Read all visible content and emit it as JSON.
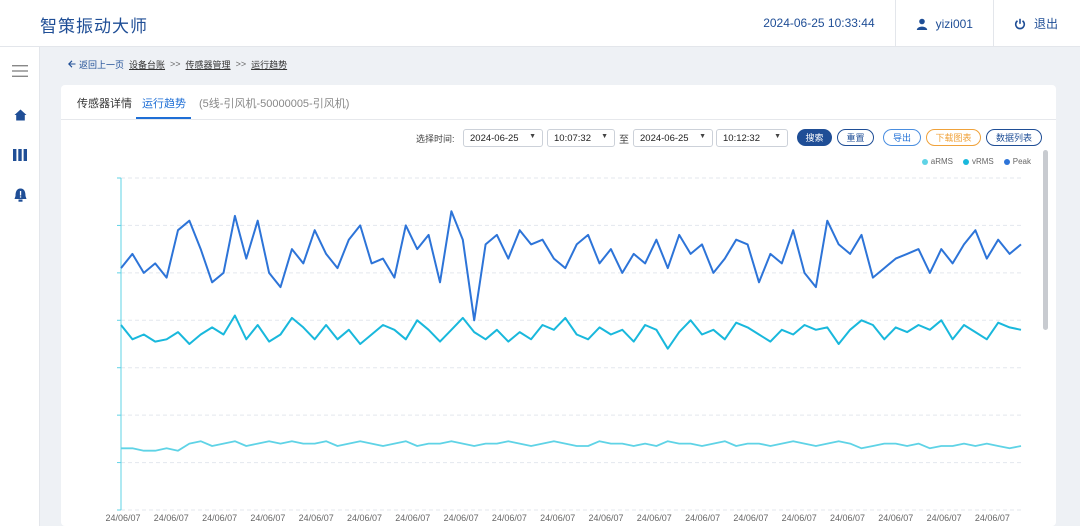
{
  "app": {
    "title": "智策振动大师"
  },
  "header": {
    "datetime": "2024-06-25 10:33:44",
    "username": "yizi001",
    "logout_label": "退出"
  },
  "sidebar": {
    "items": [
      {
        "icon": "menu-icon"
      },
      {
        "icon": "home-icon"
      },
      {
        "icon": "columns-icon"
      },
      {
        "icon": "alert-icon"
      }
    ]
  },
  "breadcrumb": {
    "back_label": "返回上一页",
    "items": [
      "设备台账",
      "传感器管理",
      "运行趋势"
    ],
    "separator": ">>"
  },
  "tabs": {
    "items": [
      "传感器详情",
      "运行趋势"
    ],
    "active": 1,
    "sensor_info": "(5线-引风机-50000005-引风机)"
  },
  "toolbar": {
    "label": "选择时间:",
    "start_date": "2024-06-25",
    "start_time": "10:07:32",
    "to_label": "至",
    "end_date": "2024-06-25",
    "end_time": "10:12:32",
    "search_label": "搜索",
    "reset_label": "重置",
    "export_label": "导出",
    "download_chart_label": "下载图表",
    "data_list_label": "数据列表"
  },
  "colors": {
    "aRMS": "#5fd3e6",
    "vRMS": "#19b8dc",
    "Peak": "#2d74d8",
    "accent": "#1f4e96"
  },
  "chart_data": {
    "type": "line",
    "x_tick_label": "24/06/07",
    "x_tick_count": 19,
    "series": [
      {
        "name": "aRMS",
        "values": [
          1.3,
          1.3,
          1.25,
          1.25,
          1.3,
          1.25,
          1.4,
          1.45,
          1.35,
          1.4,
          1.45,
          1.35,
          1.4,
          1.45,
          1.4,
          1.45,
          1.4,
          1.4,
          1.45,
          1.35,
          1.4,
          1.45,
          1.4,
          1.35,
          1.4,
          1.45,
          1.35,
          1.4,
          1.4,
          1.45,
          1.4,
          1.35,
          1.4,
          1.4,
          1.45,
          1.4,
          1.35,
          1.4,
          1.45,
          1.4,
          1.35,
          1.35,
          1.45,
          1.4,
          1.4,
          1.35,
          1.4,
          1.35,
          1.45,
          1.4,
          1.4,
          1.35,
          1.4,
          1.45,
          1.35,
          1.4,
          1.4,
          1.35,
          1.4,
          1.45,
          1.4,
          1.35,
          1.4,
          1.45,
          1.4,
          1.3,
          1.35,
          1.4,
          1.4,
          1.35,
          1.4,
          1.3,
          1.35,
          1.35,
          1.4,
          1.35,
          1.4,
          1.35,
          1.3,
          1.35
        ]
      },
      {
        "name": "vRMS",
        "values": [
          3.9,
          3.6,
          3.7,
          3.55,
          3.6,
          3.75,
          3.5,
          3.7,
          3.85,
          3.7,
          4.1,
          3.6,
          3.9,
          3.55,
          3.7,
          4.05,
          3.85,
          3.6,
          3.9,
          3.6,
          3.8,
          3.5,
          3.7,
          3.9,
          3.8,
          3.6,
          4.0,
          3.8,
          3.55,
          3.8,
          4.05,
          3.75,
          3.6,
          3.8,
          3.55,
          3.75,
          3.6,
          3.9,
          3.8,
          4.05,
          3.7,
          3.6,
          3.85,
          3.7,
          3.8,
          3.55,
          3.9,
          3.8,
          3.4,
          3.75,
          4.0,
          3.7,
          3.8,
          3.6,
          3.95,
          3.85,
          3.7,
          3.55,
          3.8,
          3.7,
          3.9,
          3.8,
          3.85,
          3.5,
          3.8,
          4.0,
          3.9,
          3.6,
          3.85,
          3.75,
          3.9,
          3.8,
          4.0,
          3.6,
          3.9,
          3.75,
          3.6,
          3.95,
          3.85,
          3.8
        ]
      },
      {
        "name": "Peak",
        "values": [
          5.1,
          5.4,
          5.0,
          5.2,
          4.9,
          5.9,
          6.1,
          5.5,
          4.8,
          5.0,
          6.2,
          5.3,
          6.1,
          5.0,
          4.7,
          5.5,
          5.2,
          5.9,
          5.4,
          5.1,
          5.7,
          6.0,
          5.2,
          5.3,
          4.9,
          6.0,
          5.5,
          5.8,
          4.8,
          6.3,
          5.7,
          4.0,
          5.6,
          5.8,
          5.3,
          5.9,
          5.6,
          5.7,
          5.3,
          5.1,
          5.6,
          5.8,
          5.2,
          5.5,
          5.0,
          5.4,
          5.2,
          5.7,
          5.1,
          5.8,
          5.4,
          5.6,
          5.0,
          5.3,
          5.7,
          5.6,
          4.8,
          5.4,
          5.2,
          5.9,
          5.0,
          4.7,
          6.1,
          5.6,
          5.4,
          5.8,
          4.9,
          5.1,
          5.3,
          5.4,
          5.5,
          5.0,
          5.5,
          5.2,
          5.6,
          5.9,
          5.3,
          5.7,
          5.4,
          5.6
        ]
      }
    ],
    "ylim": [
      0,
      7
    ],
    "grid": true,
    "legend": "top-right"
  }
}
